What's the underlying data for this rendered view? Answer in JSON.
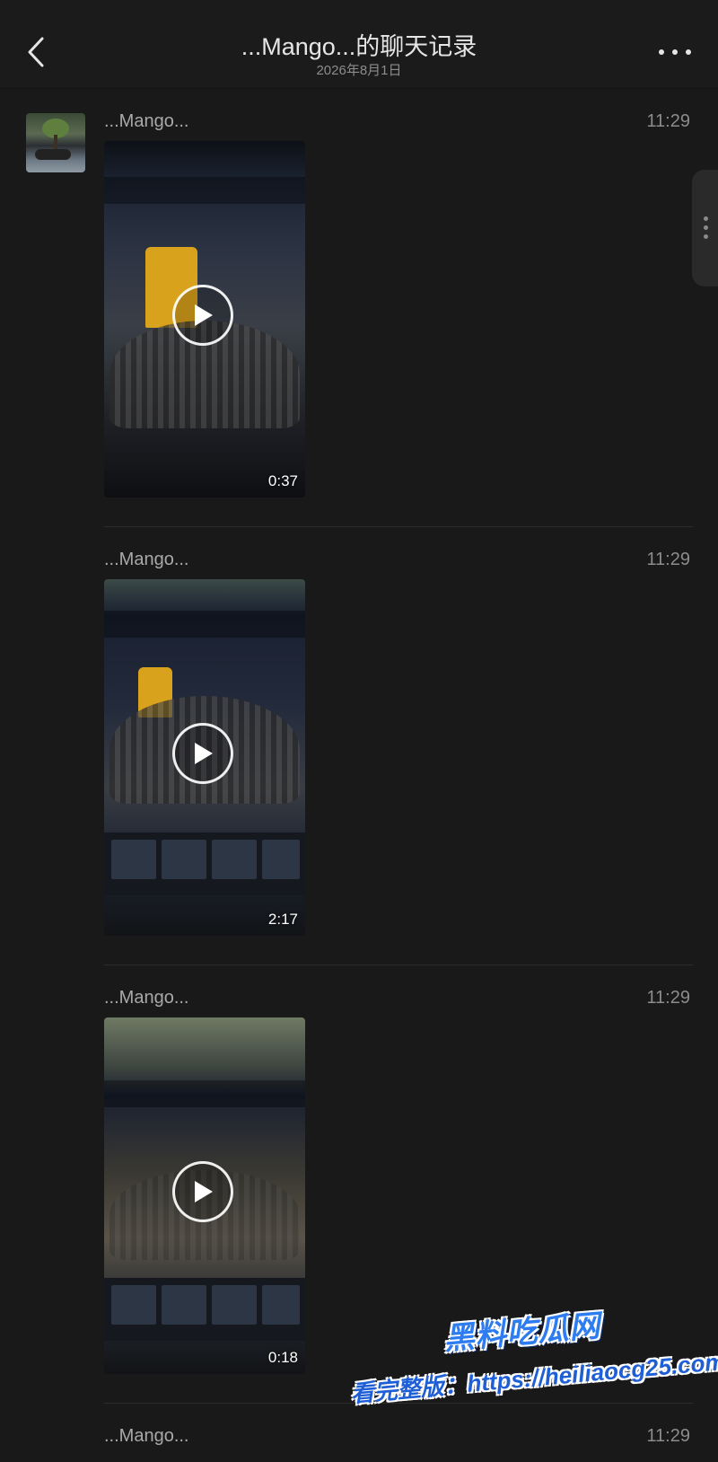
{
  "header": {
    "title": "...Mango...的聊天记录",
    "subtitle": "2026年8月1日",
    "back_icon": "chevron-left-icon",
    "more_icon": "more-horizontal-icon"
  },
  "messages": [
    {
      "sender": "...Mango...",
      "time": "11:29",
      "type": "video",
      "duration": "0:37"
    },
    {
      "sender": "...Mango...",
      "time": "11:29",
      "type": "video",
      "duration": "2:17"
    },
    {
      "sender": "...Mango...",
      "time": "11:29",
      "type": "video",
      "duration": "0:18"
    },
    {
      "sender": "...Mango...",
      "time": "11:29"
    }
  ],
  "watermark": {
    "title": "黑料吃瓜网",
    "url_text": "看完整版：https://heiliaocg25.com"
  },
  "colors": {
    "background": "#191919",
    "navbar": "#1b1b1b",
    "text_primary": "#e6e6e6",
    "text_secondary": "#8c8c8c",
    "watermark_blue": "#2d7cf0"
  }
}
